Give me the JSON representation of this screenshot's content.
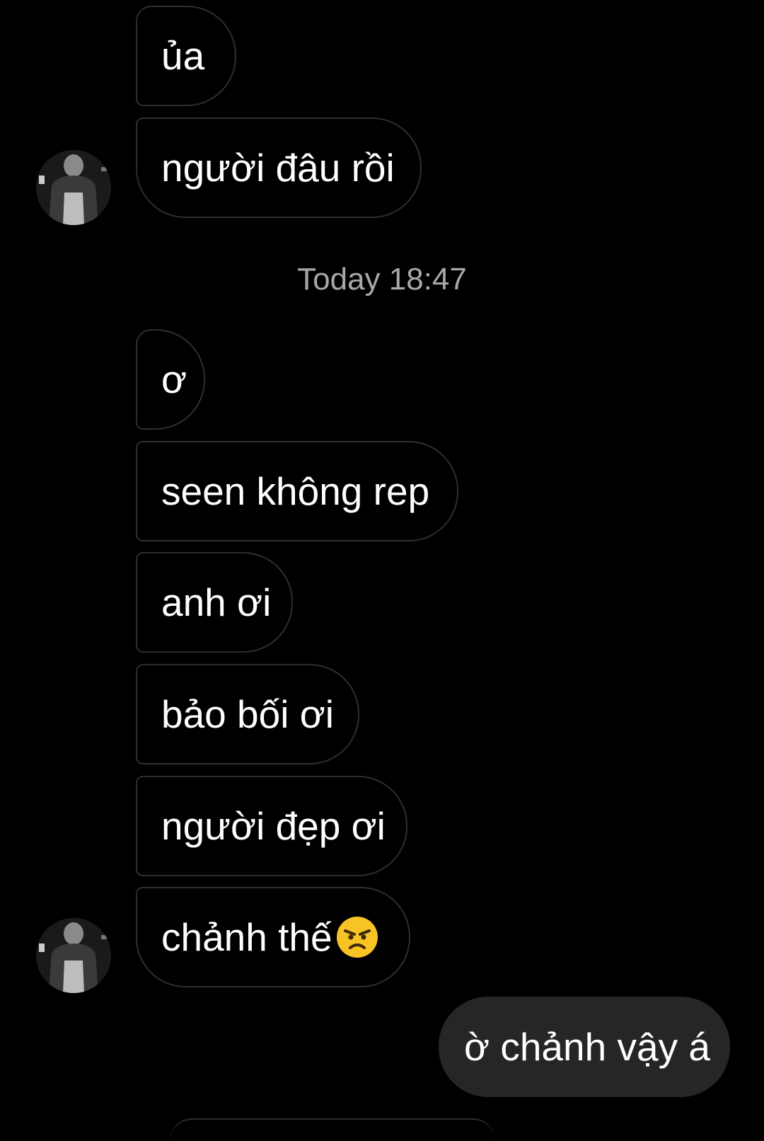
{
  "messages": [
    {
      "text": "ủa",
      "sender": "other"
    },
    {
      "text": "người đâu rồi",
      "sender": "other"
    },
    {
      "text": "ơ",
      "sender": "other"
    },
    {
      "text": "seen không rep",
      "sender": "other"
    },
    {
      "text": "anh ơi",
      "sender": "other"
    },
    {
      "text": "bảo bối ơi",
      "sender": "other"
    },
    {
      "text": "người đẹp ơi",
      "sender": "other"
    },
    {
      "text": "chảnh thế",
      "sender": "other",
      "emoji": "angry-face-emoji"
    },
    {
      "text": "ờ chảnh vậy á",
      "sender": "me"
    }
  ],
  "timestamp": "Today 18:47",
  "colors": {
    "background": "#000000",
    "incoming_border": "#2e2e2e",
    "outgoing_bubble": "#262626",
    "timestamp_text": "#a8a8a8",
    "emoji_face": "#f7c325"
  },
  "avatar_icon": "profile-avatar"
}
